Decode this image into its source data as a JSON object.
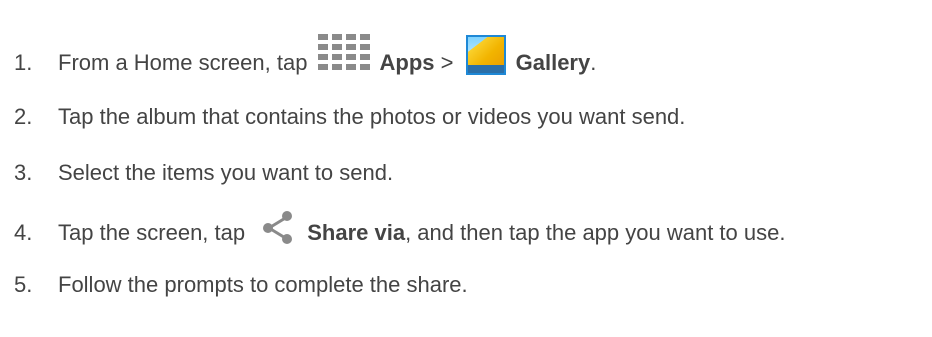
{
  "steps": [
    {
      "number": "1.",
      "text_before": "From a Home screen, tap ",
      "apps_icon": "apps-grid-icon",
      "apps_label": "Apps",
      "separator": " > ",
      "gallery_icon": "gallery-icon",
      "gallery_label": "Gallery",
      "text_after": "."
    },
    {
      "number": "2.",
      "text": "Tap the album that contains the photos or videos you want send."
    },
    {
      "number": "3.",
      "text": "Select the items you want to send."
    },
    {
      "number": "4.",
      "text_before": "Tap the screen, tap ",
      "share_icon": "share-icon",
      "share_label": "Share via",
      "text_after": ", and then tap the app you want to use."
    },
    {
      "number": "5.",
      "text": "Follow the prompts to complete the share."
    }
  ],
  "colors": {
    "text": "#444444",
    "icon_gray": "#8a8a8a",
    "gallery_border": "#1e88d6",
    "gallery_yellow": "#f2b400"
  }
}
